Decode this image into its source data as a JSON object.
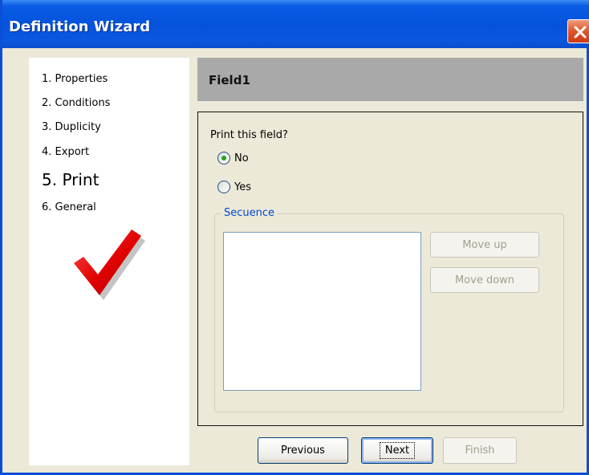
{
  "window": {
    "title": "Definition Wizard"
  },
  "steps": [
    {
      "label": "1. Properties"
    },
    {
      "label": "2. Conditions"
    },
    {
      "label": "3. Duplicity"
    },
    {
      "label": "4. Export"
    },
    {
      "label": "5. Print"
    },
    {
      "label": "6. General"
    }
  ],
  "current_step": 5,
  "field": {
    "name": "Field1"
  },
  "print_question": "Print this field?",
  "options": {
    "no": "No",
    "yes": "Yes",
    "selected": "No"
  },
  "sequence": {
    "label": "Secuence",
    "move_up": "Move up",
    "move_down": "Move down"
  },
  "navigation": {
    "previous": "Previous",
    "next": "Next",
    "finish": "Finish"
  },
  "colors": {
    "titlebar": "#0553dc",
    "checkmark": "#e00000",
    "groupbox_label": "#0046d5"
  }
}
